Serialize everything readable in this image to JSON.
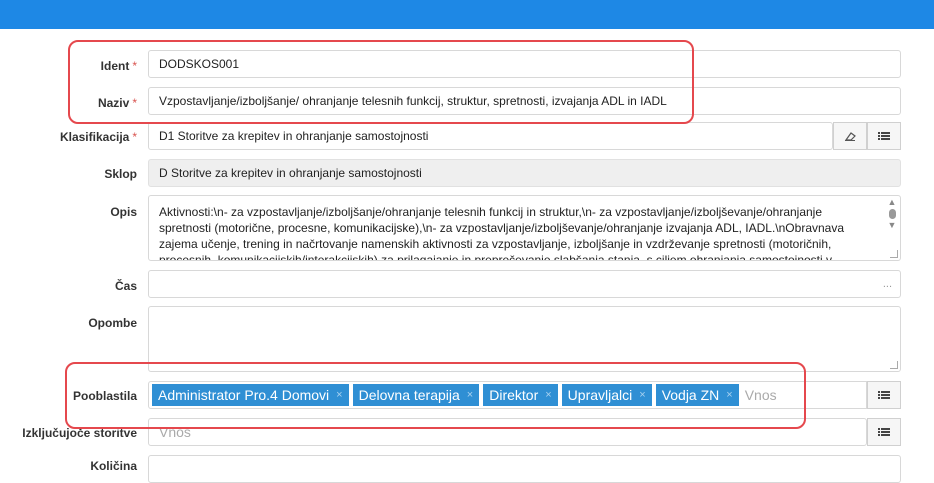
{
  "colors": {
    "topbar": "#1e88e5",
    "tag": "#2f8fd4",
    "highlight": "#e5484d",
    "required": "#d9534f"
  },
  "form": {
    "ident": {
      "label": "Ident",
      "required": "*",
      "value": "DODSKOS001"
    },
    "naziv": {
      "label": "Naziv",
      "required": "*",
      "value": "Vzpostavljanje/izboljšanje/ ohranjanje telesnih funkcij, struktur, spretnosti, izvajanja ADL in IADL"
    },
    "klasifikacija": {
      "label": "Klasifikacija",
      "required": "*",
      "value": "D1 Storitve za krepitev in ohranjanje samostojnosti",
      "clear_icon": "eraser-icon",
      "list_icon": "list-icon"
    },
    "sklop": {
      "label": "Sklop",
      "value": "D Storitve za krepitev in ohranjanje samostojnosti"
    },
    "opis": {
      "label": "Opis",
      "value": "Aktivnosti:\\n- za vzpostavljanje/izboljšanje/ohranjanje telesnih funkcij in struktur,\\n- za vzpostavljanje/izboljševanje/ohranjanje spretnosti (motorične, procesne, komunikacijske),\\n- za vzpostavljanje/izboljševanje/ohranjanje izvajanja ADL, IADL.\\nObravnava zajema učenje, trening in načrtovanje namenskih aktivnosti za vzpostavljanje, izboljšanje in vzdrževanje spretnosti (motoričnih, procesnih, komunikacijskih/interakcijskih) za prilagajanje in preprečevanje slabšanja stanja, s ciljem ohranjanja samostojnosti v"
    },
    "cas": {
      "label": "Čas",
      "value": "",
      "ellipsis": "..."
    },
    "opombe": {
      "label": "Opombe",
      "value": ""
    },
    "pooblastila": {
      "label": "Pooblastila",
      "tags": [
        "Administrator Pro.4 Domovi",
        "Delovna terapija",
        "Direktor",
        "Upravljalci",
        "Vodja ZN"
      ],
      "remove": "×",
      "placeholder": "Vnos",
      "list_icon": "list-icon"
    },
    "izkljucujoce": {
      "label": "Izključujoče storitve",
      "placeholder": "Vnos",
      "list_icon": "list-icon"
    },
    "next_label": "Količina"
  }
}
